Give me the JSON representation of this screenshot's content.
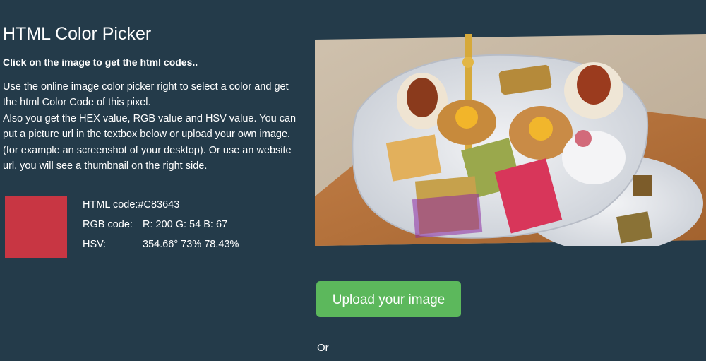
{
  "header": {
    "title": "HTML Color Picker",
    "subtitle": "Click on the image to get the html codes.."
  },
  "description": {
    "paragraph_1": "Use the online image color picker right to select a color and get the html Color Code of this pixel.",
    "paragraph_2": "Also you get the HEX value, RGB value and HSV value. You can put a picture url in the textbox below or upload your own image. (for example an screenshot of your desktop). Or use an website url, you will see a thumbnail on the right side."
  },
  "selected_color": {
    "swatch_color": "#C83643",
    "html_code_label": "HTML code:",
    "html_code_value": "#C83643",
    "rgb_label": "RGB code:",
    "rgb_value": "R: 200 G: 54 B: 67",
    "hsv_label": "HSV:",
    "hsv_value": "354.66° 73% 78.43%"
  },
  "image_panel": {
    "icon": "pastries-photo",
    "colors": {
      "background": "#243b4a",
      "carpet": "#c8b9a6",
      "plate": "#e6e8ec",
      "wood": "#b8743e"
    }
  },
  "actions": {
    "upload_label": "Upload your image",
    "upload_color": "#5cb85c",
    "or_label": "Or"
  }
}
